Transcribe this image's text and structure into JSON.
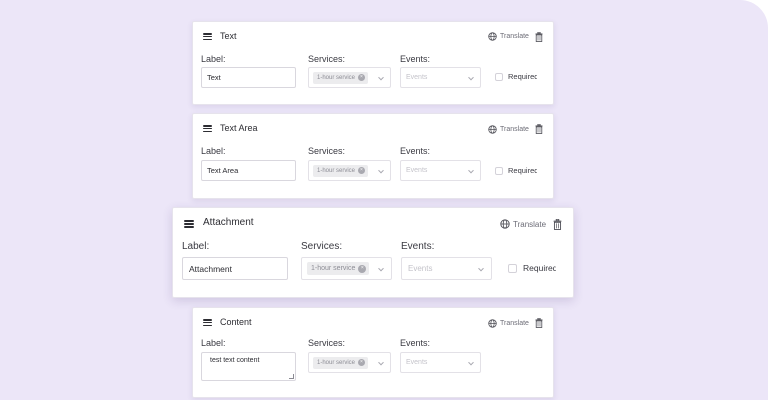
{
  "common": {
    "label_caption": "Label:",
    "services_caption": "Services:",
    "events_caption": "Events:",
    "translate_label": "Translate",
    "service_tag": "1-hour service",
    "events_placeholder": "Events",
    "required_label": "Required"
  },
  "fields": [
    {
      "title": "Text",
      "label_value": "Text",
      "has_required": true
    },
    {
      "title": "Text Area",
      "label_value": "Text Area",
      "has_required": true
    },
    {
      "title": "Attachment",
      "label_value": "Attachment",
      "has_required": true
    },
    {
      "title": "Content",
      "label_value": "test text content",
      "has_required": false
    }
  ],
  "colors": {
    "background": "#ece6f8",
    "card": "#ffffff",
    "text": "#2d2d33",
    "tag_bg": "#ececee"
  }
}
